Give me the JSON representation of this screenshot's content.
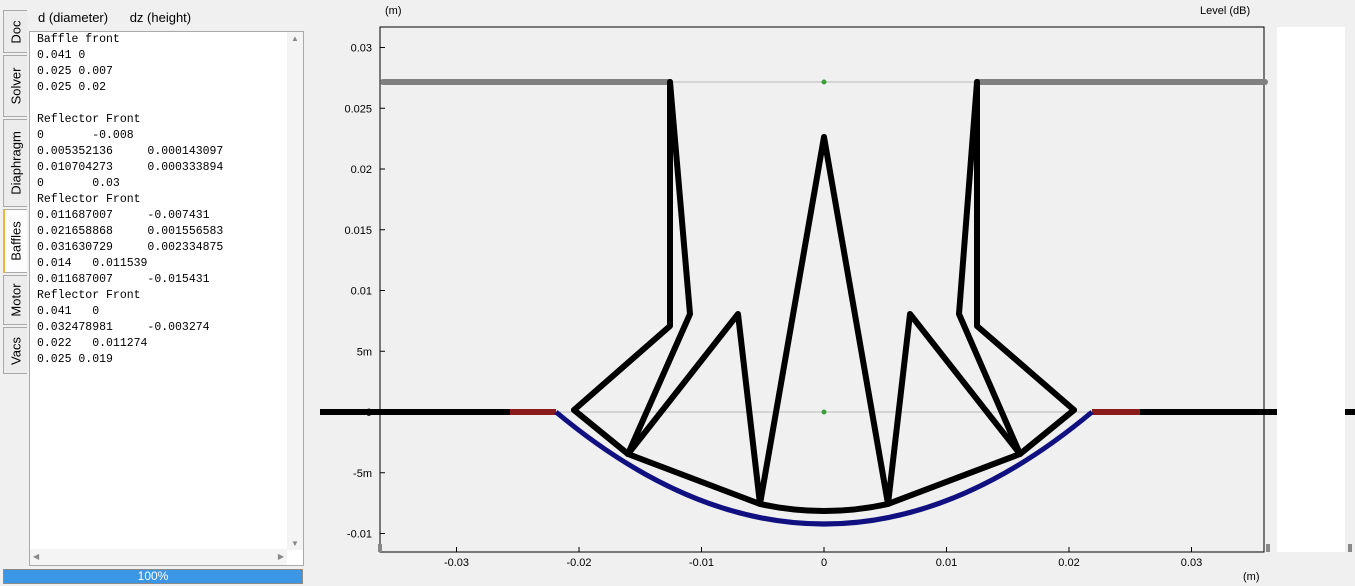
{
  "tabs": [
    {
      "label": "Doc",
      "active": false
    },
    {
      "label": "Solver",
      "active": false
    },
    {
      "label": "Diaphragm",
      "active": false
    },
    {
      "label": "Baffles",
      "active": true
    },
    {
      "label": "Motor",
      "active": false
    },
    {
      "label": "Vacs",
      "active": false
    }
  ],
  "editor": {
    "header_d": "d (diameter)",
    "header_dz": "dz (height)",
    "lines": [
      "Baffle front",
      "0.041 0",
      "0.025 0.007",
      "0.025 0.02",
      "",
      "Reflector Front",
      "0       -0.008",
      "0.005352136     0.000143097",
      "0.010704273     0.000333894",
      "0       0.03",
      "Reflector Front",
      "0.011687007     -0.007431",
      "0.021658868     0.001556583",
      "0.031630729     0.002334875",
      "0.014   0.011539",
      "0.011687007     -0.015431",
      "Reflector Front",
      "0.041   0",
      "0.032478981     -0.003274",
      "0.022   0.011274",
      "0.025 0.019"
    ]
  },
  "progress": {
    "label": "100%",
    "value": 1.0
  },
  "plot": {
    "y_unit_label": "(m)",
    "x_unit_label": "(m)",
    "level_label": "Level  (dB)",
    "y_ticks": [
      {
        "v": 0.03,
        "label": "0.03"
      },
      {
        "v": 0.025,
        "label": "0.025"
      },
      {
        "v": 0.02,
        "label": "0.02"
      },
      {
        "v": 0.015,
        "label": "0.015"
      },
      {
        "v": 0.01,
        "label": "0.01"
      },
      {
        "v": 0.005,
        "label": "5m"
      },
      {
        "v": 0.0,
        "label": "0"
      },
      {
        "v": -0.005,
        "label": "-5m"
      },
      {
        "v": -0.01,
        "label": "-0.01"
      }
    ],
    "x_ticks": [
      {
        "v": -0.03,
        "label": "-0.03"
      },
      {
        "v": -0.02,
        "label": "-0.02"
      },
      {
        "v": -0.01,
        "label": "-0.01"
      },
      {
        "v": 0.0,
        "label": "0"
      },
      {
        "v": 0.01,
        "label": "0.01"
      },
      {
        "v": 0.02,
        "label": "0.02"
      },
      {
        "v": 0.03,
        "label": "0.03"
      }
    ],
    "colors": {
      "structure": "#000000",
      "baffle_top": "#808080",
      "diaphragm": "#101080",
      "surround": "#8b1a1a",
      "axis_line": "#b8b8b8",
      "marker": "#3aa03a"
    }
  }
}
